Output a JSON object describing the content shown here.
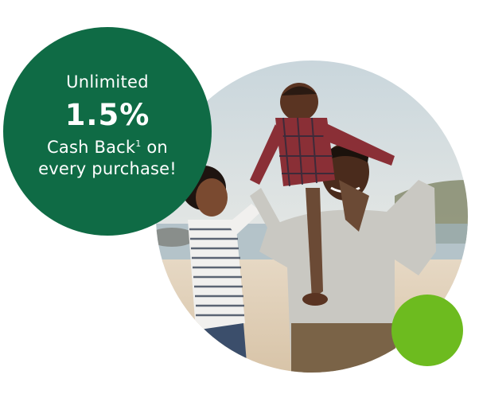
{
  "promo": {
    "line1": "Unlimited",
    "rate": "1.5%",
    "line3_main": "Cash Back",
    "line3_sup": "1",
    "line3_tail": " on",
    "line4": "every purchase!"
  },
  "colors": {
    "promo_circle": "#0f6b45",
    "accent_dot": "#6dbb1f",
    "background": "#ffffff"
  },
  "photo": {
    "subject": "family-on-beach-photo"
  }
}
